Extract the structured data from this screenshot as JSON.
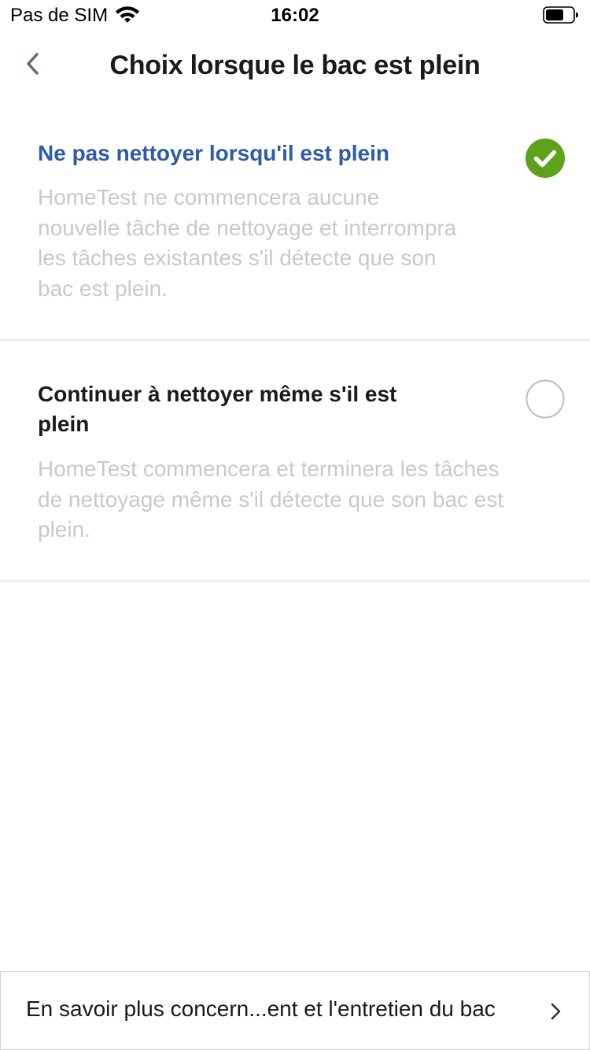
{
  "status_bar": {
    "carrier": "Pas de SIM",
    "time": "16:02",
    "icons": [
      "wifi-icon",
      "battery-icon"
    ]
  },
  "nav": {
    "title": "Choix lorsque le bac est plein",
    "back_icon": "chevron-left-icon"
  },
  "options": [
    {
      "title": "Ne pas nettoyer lorsqu'il est plein",
      "description": "HomeTest ne commencera aucune nouvelle tâche de nettoyage et interrompra les tâches existantes s'il détecte que son bac est plein.",
      "selected": true
    },
    {
      "title": "Continuer à nettoyer même s'il est plein",
      "description": "HomeTest commencera et terminera les tâches de nettoyage même s'il détecte que son bac est plein.",
      "selected": false
    }
  ],
  "footer": {
    "link_text": "En savoir plus concern...ent et l'entretien du bac",
    "icon": "chevron-right-icon"
  },
  "colors": {
    "selected_title": "#2e5aa8",
    "check_green": "#5ea11b",
    "description": "#c9c9c9",
    "divider": "#f2f2f2"
  }
}
